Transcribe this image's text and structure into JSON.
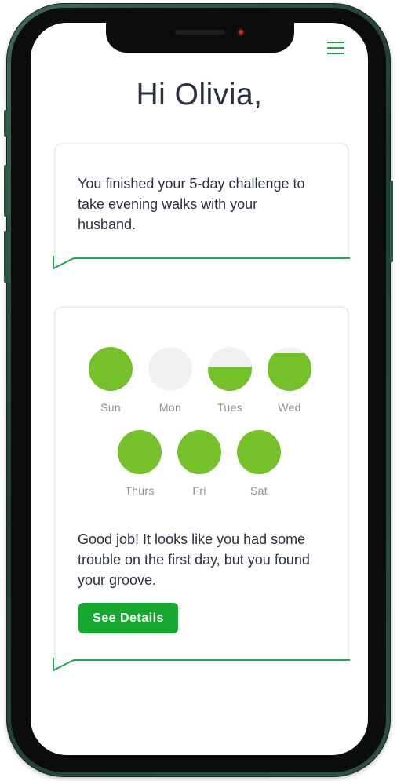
{
  "greeting": "Hi Olivia,",
  "challenge_card": {
    "message": "You finished your 5-day challenge to take evening walks with your husband."
  },
  "week_card": {
    "days": [
      {
        "label": "Sun",
        "progress": 1.0
      },
      {
        "label": "Mon",
        "progress": 0.0
      },
      {
        "label": "Tues",
        "progress": 0.55
      },
      {
        "label": "Wed",
        "progress": 0.85
      },
      {
        "label": "Thurs",
        "progress": 1.0
      },
      {
        "label": "Fri",
        "progress": 1.0
      },
      {
        "label": "Sat",
        "progress": 1.0
      }
    ],
    "message": "Good job! It looks like you had some trouble on the first day, but you found your groove.",
    "button_label": "See Details"
  },
  "colors": {
    "accent_green": "#16a82f",
    "progress_green": "#74c12a",
    "empty_gray": "#f1f1f1"
  },
  "icons": {
    "menu": "hamburger-menu-icon"
  }
}
